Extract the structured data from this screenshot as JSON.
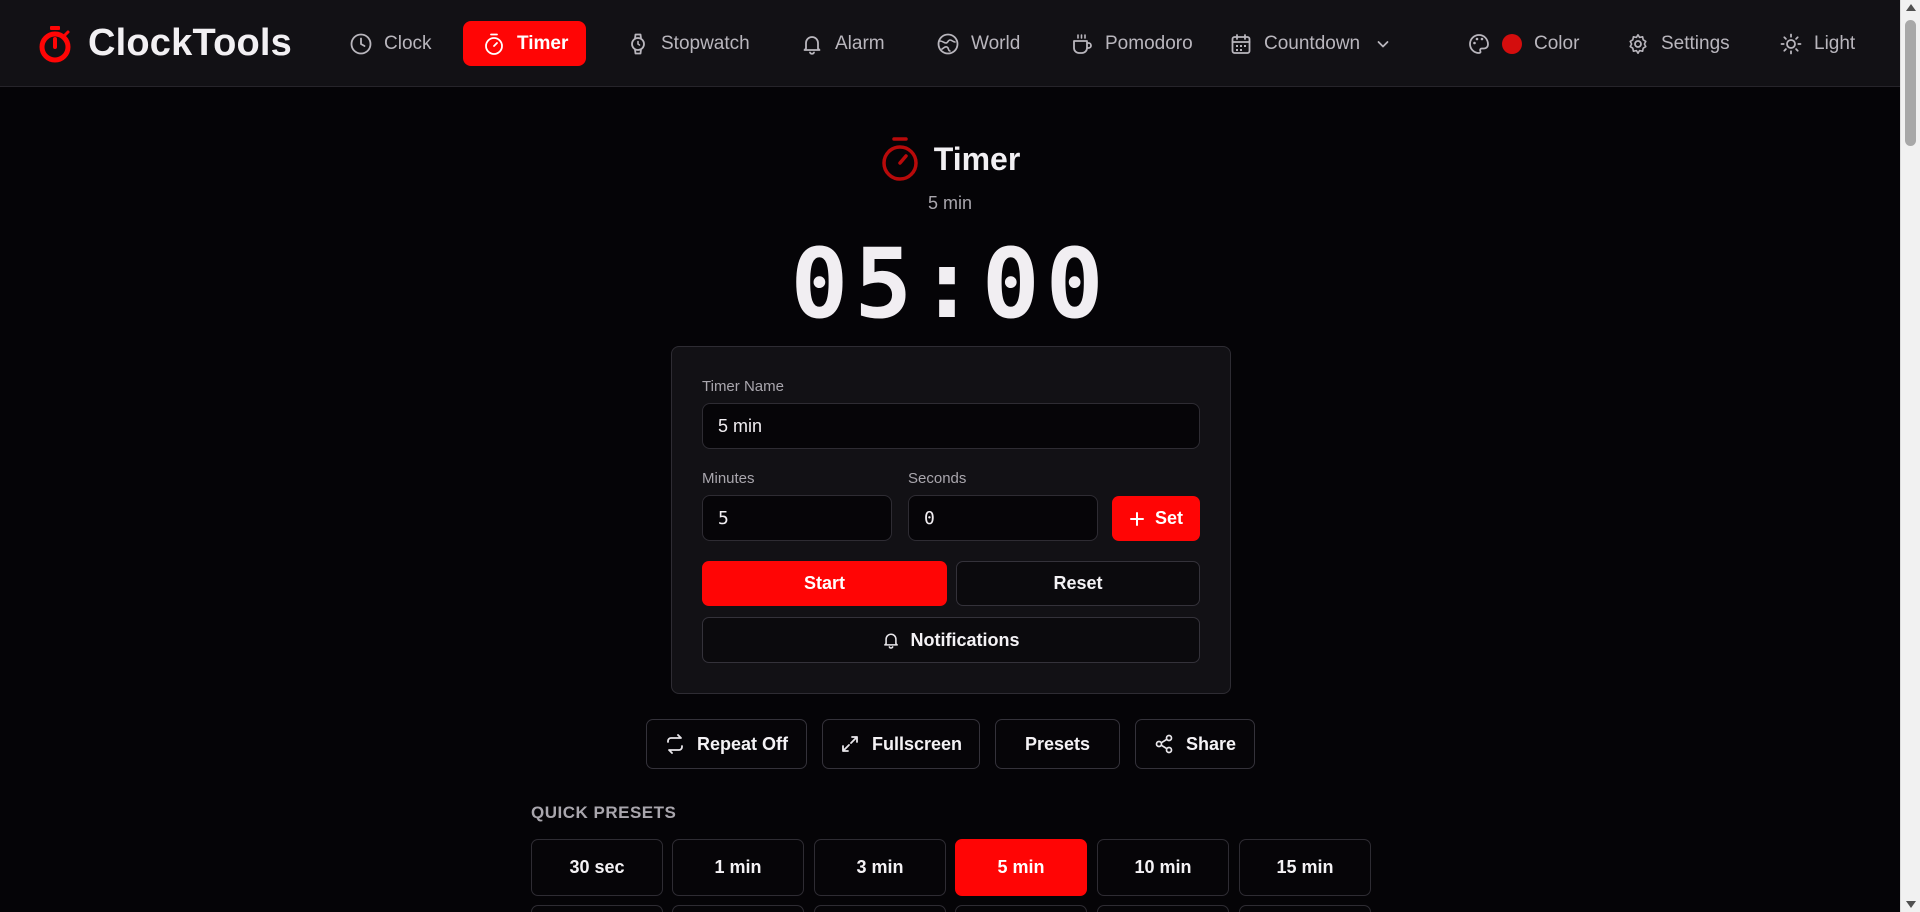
{
  "brand": {
    "name": "ClockTools"
  },
  "nav": {
    "items": [
      {
        "label": "Clock",
        "icon": "clock-icon"
      },
      {
        "label": "Timer",
        "icon": "timer-icon",
        "active": true
      },
      {
        "label": "Stopwatch",
        "icon": "watch-icon"
      },
      {
        "label": "Alarm",
        "icon": "bell-icon"
      },
      {
        "label": "World",
        "icon": "globe-icon"
      },
      {
        "label": "Pomodoro",
        "icon": "coffee-icon"
      },
      {
        "label": "Countdown",
        "icon": "calendar-icon"
      }
    ],
    "color_label": "Color",
    "settings_label": "Settings",
    "theme_label": "Light"
  },
  "colors": {
    "accent": "#ff0505",
    "background": "#050407",
    "card": "#121115",
    "color_swatch": "#d40d0d"
  },
  "timer": {
    "title": "Timer",
    "subtitle": "5 min",
    "display": "05:00"
  },
  "form": {
    "name_label": "Timer Name",
    "name_value": "5 min",
    "minutes_label": "Minutes",
    "minutes_value": "5",
    "seconds_label": "Seconds",
    "seconds_value": "0",
    "set_label": "Set",
    "start_label": "Start",
    "reset_label": "Reset",
    "notifications_label": "Notifications"
  },
  "actions": {
    "repeat_label": "Repeat Off",
    "fullscreen_label": "Fullscreen",
    "presets_label": "Presets",
    "share_label": "Share"
  },
  "quick_presets": {
    "heading": "QUICK PRESETS",
    "items": [
      {
        "label": "30 sec"
      },
      {
        "label": "1 min"
      },
      {
        "label": "3 min"
      },
      {
        "label": "5 min",
        "active": true
      },
      {
        "label": "10 min"
      },
      {
        "label": "15 min"
      }
    ]
  }
}
